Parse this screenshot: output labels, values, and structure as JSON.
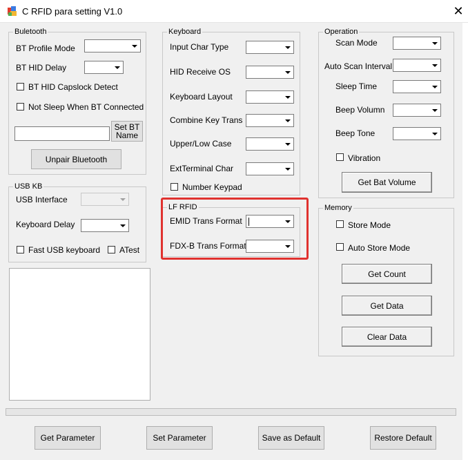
{
  "window": {
    "title": "C RFID para setting V1.0",
    "close_glyph": "✕"
  },
  "bluetooth": {
    "legend": "Buletooth",
    "bt_profile_mode": "BT Profile Mode",
    "bt_hid_delay": "BT HID Delay",
    "capslock_detect": "BT HID Capslock Detect",
    "not_sleep": "Not Sleep When BT Connected",
    "name_input": "",
    "set_bt_name_line1": "Set BT",
    "set_bt_name_line2": "Name",
    "unpair": "Unpair Bluetooth"
  },
  "usb_kb": {
    "legend": "USB KB",
    "usb_interface": "USB Interface",
    "keyboard_delay": "Keyboard Delay",
    "fast_usb": "Fast USB keyboard",
    "atest": "ATest"
  },
  "keyboard": {
    "legend": "Keyboard",
    "input_char_type": "Input Char Type",
    "hid_receive_os": "HID Receive OS",
    "keyboard_layout": "Keyboard Layout",
    "combine_key_trans": "Combine Key Trans",
    "upper_low_case": "Upper/Low Case",
    "ext_terminal_char": "ExtTerminal Char",
    "number_keypad": "Number Keypad"
  },
  "lf_rfid": {
    "legend": "LF RFID",
    "emid_trans_format": "EMID Trans Format",
    "fdxb_trans_format": "FDX-B Trans Format"
  },
  "operation": {
    "legend": "Operation",
    "scan_mode": "Scan Mode",
    "auto_scan_interval": "Auto Scan Interval",
    "sleep_time": "Sleep Time",
    "beep_volumn": "Beep Volumn",
    "beep_tone": "Beep Tone",
    "vibration": "Vibration",
    "get_bat_volume": "Get Bat Volume"
  },
  "memory": {
    "legend": "Memory",
    "store_mode": "Store Mode",
    "auto_store_mode": "Auto Store Mode",
    "get_count": "Get Count",
    "get_data": "Get Data",
    "clear_data": "Clear Data"
  },
  "footer": {
    "get_parameter": "Get Parameter",
    "set_parameter": "Set Parameter",
    "save_as_default": "Save as Default",
    "restore_default": "Restore Default"
  },
  "colors": {
    "highlight": "#e0322f",
    "dialog_bg": "#f0f0f0",
    "button_bg": "#e1e1e1"
  },
  "icons": {
    "app": "rfid-app-icon",
    "close": "close-icon",
    "dropdown": "chevron-down-icon"
  }
}
